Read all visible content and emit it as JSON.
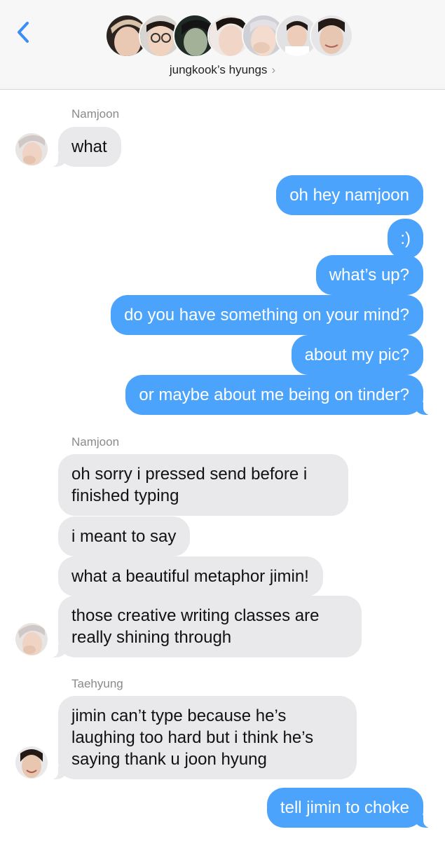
{
  "header": {
    "group_name": "jungkook’s hyungs",
    "chevron": "›",
    "back_icon": "chevron-left-icon",
    "accent": "#3b8df7"
  },
  "participants": [
    {
      "avatar": "avatar-photo-1"
    },
    {
      "avatar": "avatar-photo-2"
    },
    {
      "avatar": "avatar-photo-3"
    },
    {
      "avatar": "avatar-photo-4"
    },
    {
      "avatar": "avatar-photo-5"
    },
    {
      "avatar": "avatar-photo-6"
    },
    {
      "avatar": "avatar-photo-7"
    }
  ],
  "colors": {
    "incoming_bubble": "#e9e9eb",
    "outgoing_bubble": "#4ba3fb",
    "sender_name": "#8a8a8e"
  },
  "conversation": {
    "senders": [
      "Namjoon",
      "Namjoon",
      "Taehyung"
    ],
    "messages": [
      "what",
      "oh hey namjoon",
      ":)",
      "what’s up?",
      "do you have something on your mind?",
      "about my pic?",
      "or maybe about me being on tinder?",
      "oh sorry i pressed send before i finished typing",
      "i meant to say",
      "what a beautiful metaphor jimin!",
      "those creative writing classes are really shining through",
      "jimin can’t type because he’s laughing too hard but i think he’s saying thank u joon hyung",
      "tell jimin to choke"
    ]
  }
}
